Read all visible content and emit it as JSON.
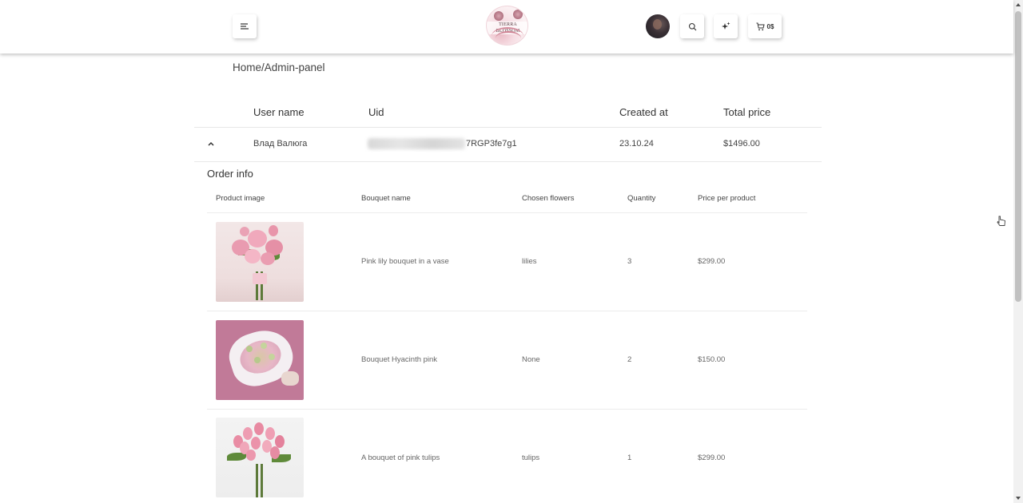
{
  "header": {
    "logo_text": "TIERRA BLOSSOM",
    "cart_total": "0$"
  },
  "breadcrumb": "Home/Admin-panel",
  "users_table": {
    "columns": [
      "User name",
      "Uid",
      "Created at",
      "Total price"
    ],
    "rows": [
      {
        "user_name": "Влад Валюга",
        "uid_visible": "7RGP3fe7g1",
        "created_at": "23.10.24",
        "total_price": "$1496.00"
      }
    ]
  },
  "order_info": {
    "title": "Order info",
    "columns": [
      "Product image",
      "Bouquet name",
      "Chosen flowers",
      "Quantity",
      "Price per product"
    ],
    "rows": [
      {
        "image": "pink-lily-bouquet-image",
        "bouquet_name": "Pink lily bouquet in a vase",
        "chosen_flowers": "lilies",
        "quantity": "3",
        "price": "$299.00"
      },
      {
        "image": "hyacinth-bouquet-image",
        "bouquet_name": "Bouquet Hyacinth pink",
        "chosen_flowers": "None",
        "quantity": "2",
        "price": "$150.00"
      },
      {
        "image": "pink-tulips-bouquet-image",
        "bouquet_name": "A bouquet of pink tulips",
        "chosen_flowers": "tulips",
        "quantity": "1",
        "price": "$299.00"
      }
    ]
  },
  "colors": {
    "accent_pink": "#c17a98",
    "text_dark": "#333333",
    "divider": "#e8e8e8"
  }
}
